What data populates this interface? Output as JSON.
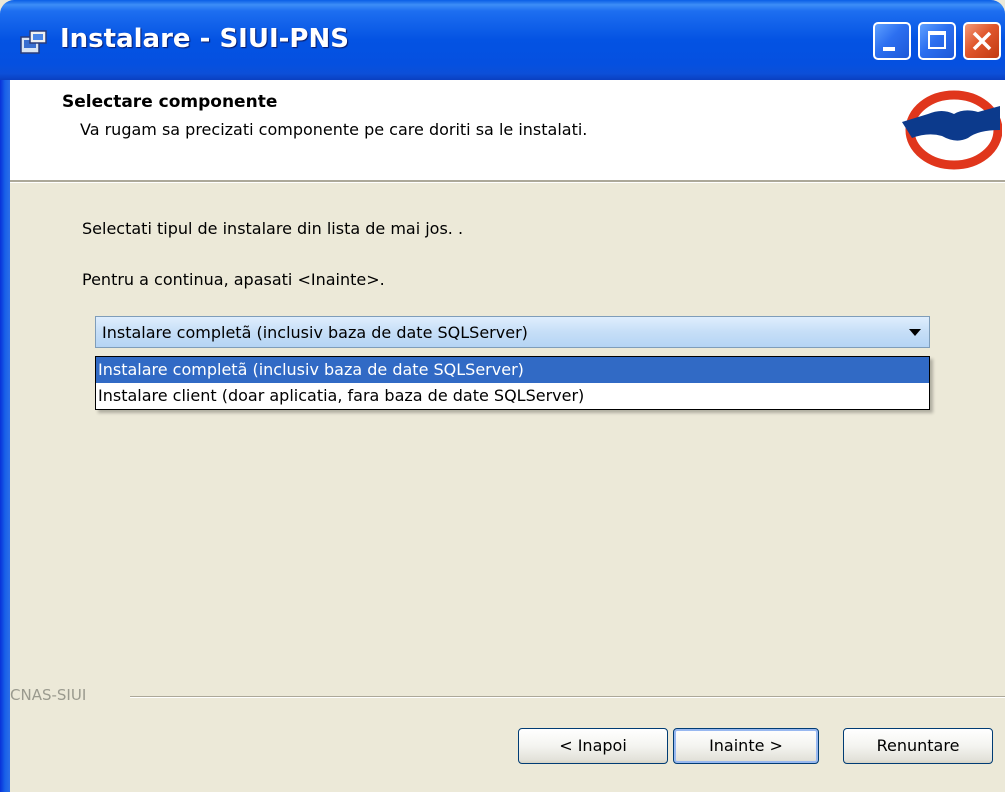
{
  "window": {
    "title": "Instalare - SIUI-PNS",
    "controls": [
      "minimize-icon",
      "maximize-icon",
      "close-icon"
    ]
  },
  "header": {
    "title": "Selectare componente",
    "subtitle": "Va rugam sa precizati componente pe care doriti sa le instalati."
  },
  "content": {
    "line1": "Selectati tipul de instalare din lista de mai jos. .",
    "line2": "Pentru a continua, apasati <Inainte>."
  },
  "combo": {
    "selected": "Instalare completã (inclusiv baza de date SQLServer)",
    "options": [
      "Instalare completã (inclusiv baza de date SQLServer)",
      "Instalare client (doar aplicatia, fara baza de date SQLServer)"
    ]
  },
  "footer": {
    "group_label": "CNAS-SIUI",
    "back_label": "< Inapoi",
    "next_label": "Inainte >",
    "cancel_label": "Renuntare"
  },
  "colors": {
    "titlebar": "#0453e3",
    "selection": "#316ac5",
    "close_button": "#e0572c"
  }
}
